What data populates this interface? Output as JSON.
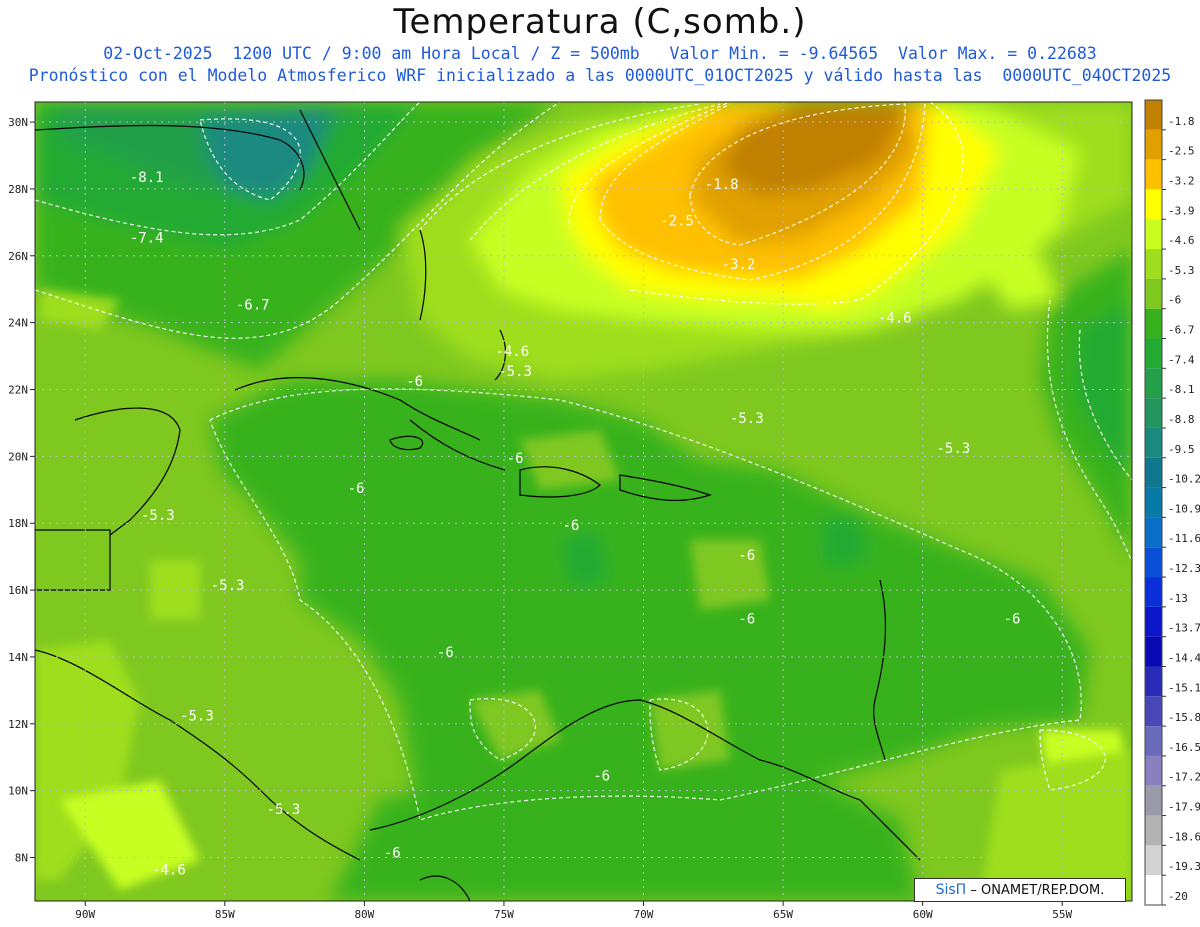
{
  "header": {
    "title": "Temperatura (C,somb.)",
    "subtitle_line1": "02-Oct-2025  1200 UTC / 9:00 am Hora Local / Z = 500mb   Valor Min. = -9.64565  Valor Max. = 0.22683",
    "subtitle_line2": "Pronóstico con el Modelo Atmosferico WRF inicializado a las 0000UTC_01OCT2025 y válido hasta las  0000UTC_04OCT2025"
  },
  "axes": {
    "lat_labels": [
      "30N",
      "28N",
      "26N",
      "24N",
      "22N",
      "20N",
      "18N",
      "16N",
      "14N",
      "12N",
      "10N",
      "8N"
    ],
    "lat_values": [
      30,
      28,
      26,
      24,
      22,
      20,
      18,
      16,
      14,
      12,
      10,
      8
    ],
    "lon_labels": [
      "90W",
      "85W",
      "80W",
      "75W",
      "70W",
      "65W",
      "60W",
      "55W"
    ],
    "lon_values": [
      -90,
      -85,
      -80,
      -75,
      -70,
      -65,
      -60,
      -55
    ],
    "lat_range": [
      6.7,
      30.6
    ],
    "lon_range": [
      -91.8,
      -52.5
    ],
    "grid": "dotted"
  },
  "colorbar": {
    "labels": [
      "-1.8",
      "-2.5",
      "-3.2",
      "-3.9",
      "-4.6",
      "-5.3",
      "-6",
      "-6.7",
      "-7.4",
      "-8.1",
      "-8.8",
      "-9.5",
      "-10.2",
      "-10.9",
      "-11.6",
      "-12.3",
      "-13",
      "-13.7",
      "-14.4",
      "-15.1",
      "-15.8",
      "-16.5",
      "-17.2",
      "-17.9",
      "-18.6",
      "-19.3",
      "-20"
    ],
    "colors": [
      "#c08000",
      "#e0a000",
      "#ffc000",
      "#ffff00",
      "#c8ff20",
      "#9ede1e",
      "#7fc820",
      "#37b21e",
      "#22aa33",
      "#24a04a",
      "#25955e",
      "#1a8a80",
      "#10788e",
      "#087aa8",
      "#0a6fc8",
      "#0a4fd8",
      "#0a2fd8",
      "#0a16c8",
      "#0a0ab4",
      "#2a2ab8",
      "#4848b8",
      "#6a6aba",
      "#8a80c0",
      "#9a9aaa",
      "#b2b2b2",
      "#d2d2d2",
      "#ffffff"
    ]
  },
  "contour_labels": [
    {
      "text": "-8.1",
      "lat": 28.2,
      "lon": -87.8
    },
    {
      "text": "-7.4",
      "lat": 26.4,
      "lon": -87.8
    },
    {
      "text": "-6.7",
      "lat": 24.4,
      "lon": -84.0
    },
    {
      "text": "-1.8",
      "lat": 28.0,
      "lon": -67.2
    },
    {
      "text": "-2.5",
      "lat": 26.9,
      "lon": -68.8
    },
    {
      "text": "-3.2",
      "lat": 25.6,
      "lon": -66.6
    },
    {
      "text": "-4.6",
      "lat": 24.0,
      "lon": -61.0
    },
    {
      "text": "-4.6",
      "lat": 23.0,
      "lon": -74.7
    },
    {
      "text": "-5.3",
      "lat": 22.4,
      "lon": -74.6
    },
    {
      "text": "-6",
      "lat": 22.1,
      "lon": -78.2
    },
    {
      "text": "-5.3",
      "lat": 21.0,
      "lon": -66.3
    },
    {
      "text": "-5.3",
      "lat": 20.1,
      "lon": -58.9
    },
    {
      "text": "-6",
      "lat": 19.8,
      "lon": -74.6
    },
    {
      "text": "-6",
      "lat": 18.9,
      "lon": -80.3
    },
    {
      "text": "-5.3",
      "lat": 18.1,
      "lon": -87.4
    },
    {
      "text": "-6",
      "lat": 17.8,
      "lon": -72.6
    },
    {
      "text": "-6",
      "lat": 16.9,
      "lon": -66.3
    },
    {
      "text": "-5.3",
      "lat": 16.0,
      "lon": -84.9
    },
    {
      "text": "-6",
      "lat": 15.0,
      "lon": -66.3
    },
    {
      "text": "-6",
      "lat": 15.0,
      "lon": -56.8
    },
    {
      "text": "-6",
      "lat": 14.0,
      "lon": -77.1
    },
    {
      "text": "-5.3",
      "lat": 12.1,
      "lon": -86.0
    },
    {
      "text": "-6",
      "lat": 10.3,
      "lon": -71.5
    },
    {
      "text": "-5.3",
      "lat": 9.3,
      "lon": -82.9
    },
    {
      "text": "-4.6",
      "lat": 7.5,
      "lon": -87.0
    },
    {
      "text": "-6",
      "lat": 8.0,
      "lon": -79.0
    }
  ],
  "credit": {
    "brand": "SisΠ",
    "text": "– ONAMET/REP.DOM."
  }
}
